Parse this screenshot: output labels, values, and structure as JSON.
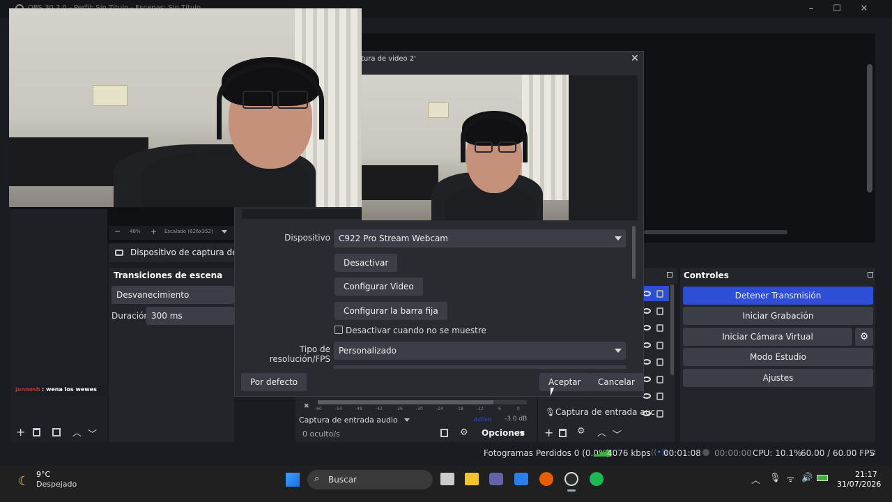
{
  "window": {
    "title": "OBS 30.2.0 - Perfil: Sin Título - Escenas: Sin Título"
  },
  "dialog": {
    "title": "tura de video 2'",
    "device_label": "Dispositivo",
    "device_value": "C922 Pro Stream Webcam",
    "btn_deactivate": "Desactivar",
    "btn_config_video": "Configurar Video",
    "btn_config_bar": "Configurar la barra fija",
    "checkbox_label": "Desactivar cuando no se muestre",
    "res_label": "Tipo de resolución/FPS",
    "res_value": "Personalizado",
    "btn_default": "Por defecto",
    "btn_accept": "Aceptar",
    "btn_cancel": "Cancelar"
  },
  "preview_toolbar": {
    "zoom": "48%",
    "scaled": "Escalado (626x352)"
  },
  "source_row": {
    "label": "Dispositivo de captura de v"
  },
  "transitions": {
    "title": "Transiciones de escena",
    "value": "Desvanecimiento",
    "duration_label": "Duración",
    "duration_value": "300 ms"
  },
  "chat": {
    "user": "jonnosh",
    "message": ": wena los wewes"
  },
  "mixer": {
    "ticks": [
      "-60",
      "-54",
      "-48",
      "-42",
      "-36",
      "-30",
      "-24",
      "-18",
      "-12",
      "-6",
      "0"
    ],
    "source": "Captura de entrada audio",
    "state": "Activo",
    "db": "-3.0 dB",
    "hidden": "0 oculto/s",
    "options": "Opciones"
  },
  "sources": {
    "last_item": "Captura de entrada auc"
  },
  "controls": {
    "title": "Controles",
    "buttons": [
      "Detener Transmisión",
      "Iniciar Grabación",
      "Iniciar Cámara Virtual",
      "Modo Estudio",
      "Ajustes"
    ]
  },
  "statusbar": {
    "dropped": "Fotogramas Perdidos 0 (0.0%)",
    "bitrate": "4076 kbps",
    "stream_time": "00:01:08",
    "rec_time": "00:00:00",
    "cpu": "CPU: 10.1%",
    "fps": "60.00 / 60.00 FPS"
  },
  "taskbar": {
    "temp": "9°C",
    "weather": "Despejado",
    "search": "Buscar",
    "time": "21:17",
    "date": "31/07/2026"
  },
  "colors": {
    "accent": "#2d4fd6",
    "panel": "#24252b",
    "button": "#3c3e46"
  }
}
